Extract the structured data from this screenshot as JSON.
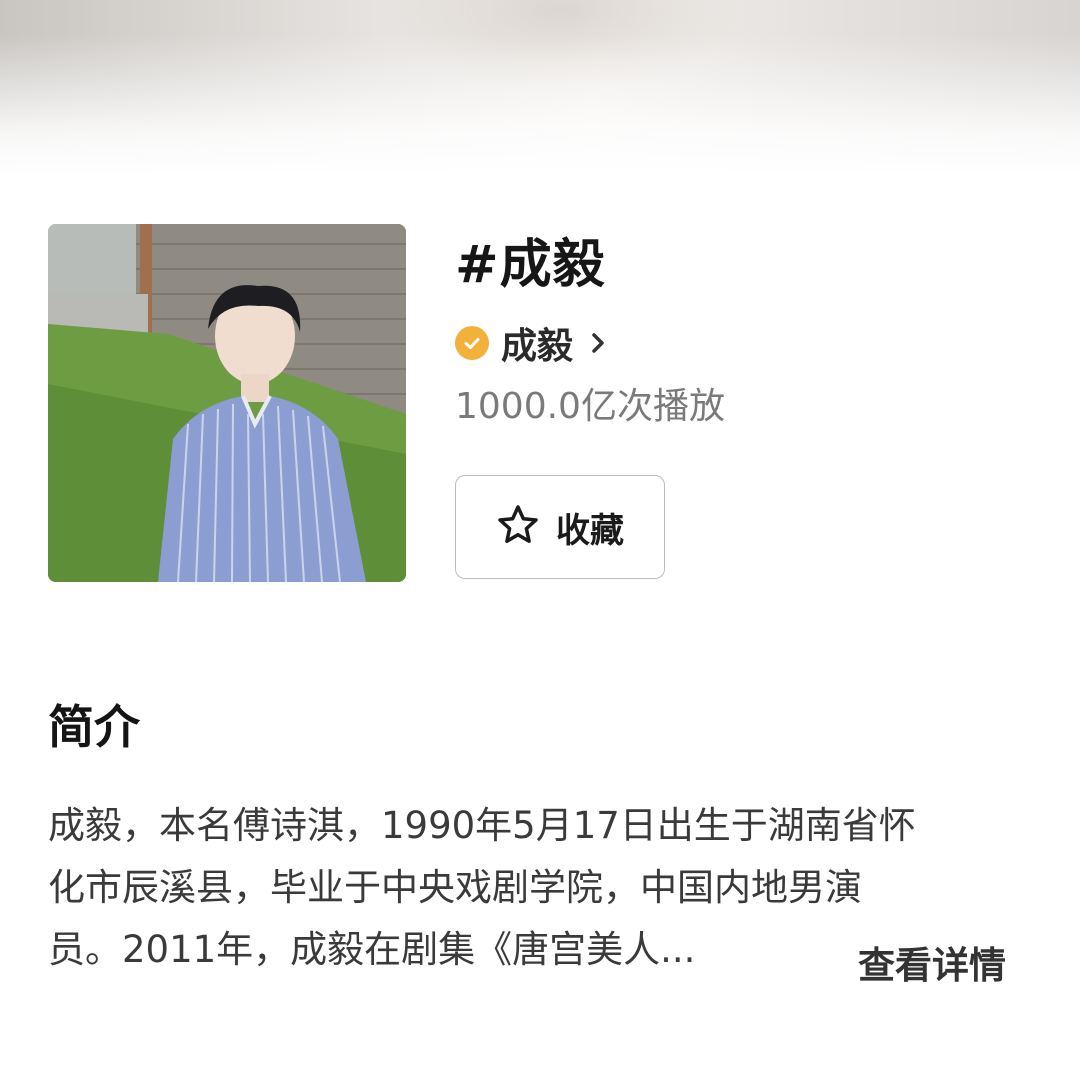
{
  "topic": {
    "title": "#成毅",
    "creator_name": "成毅",
    "plays": "1000.0亿次播放",
    "favorite_label": "收藏"
  },
  "intro": {
    "heading": "简介",
    "lines": [
      "成毅，本名傅诗淇，1990年5月17日出生于湖南省怀",
      "化市辰溪县，毕业于中央戏剧学院，中国内地男演",
      "员。2011年，成毅在剧集《唐宫美人..."
    ],
    "more_label": "查看详情"
  },
  "icons": {
    "verified": "verified-check-icon",
    "chevron": "chevron-right-icon",
    "favorite": "star-outline-icon"
  },
  "colors": {
    "verified": "#f2b13b",
    "title": "#161616",
    "secondary_text": "#7a7a7a",
    "button_border": "#bdbdbd"
  }
}
